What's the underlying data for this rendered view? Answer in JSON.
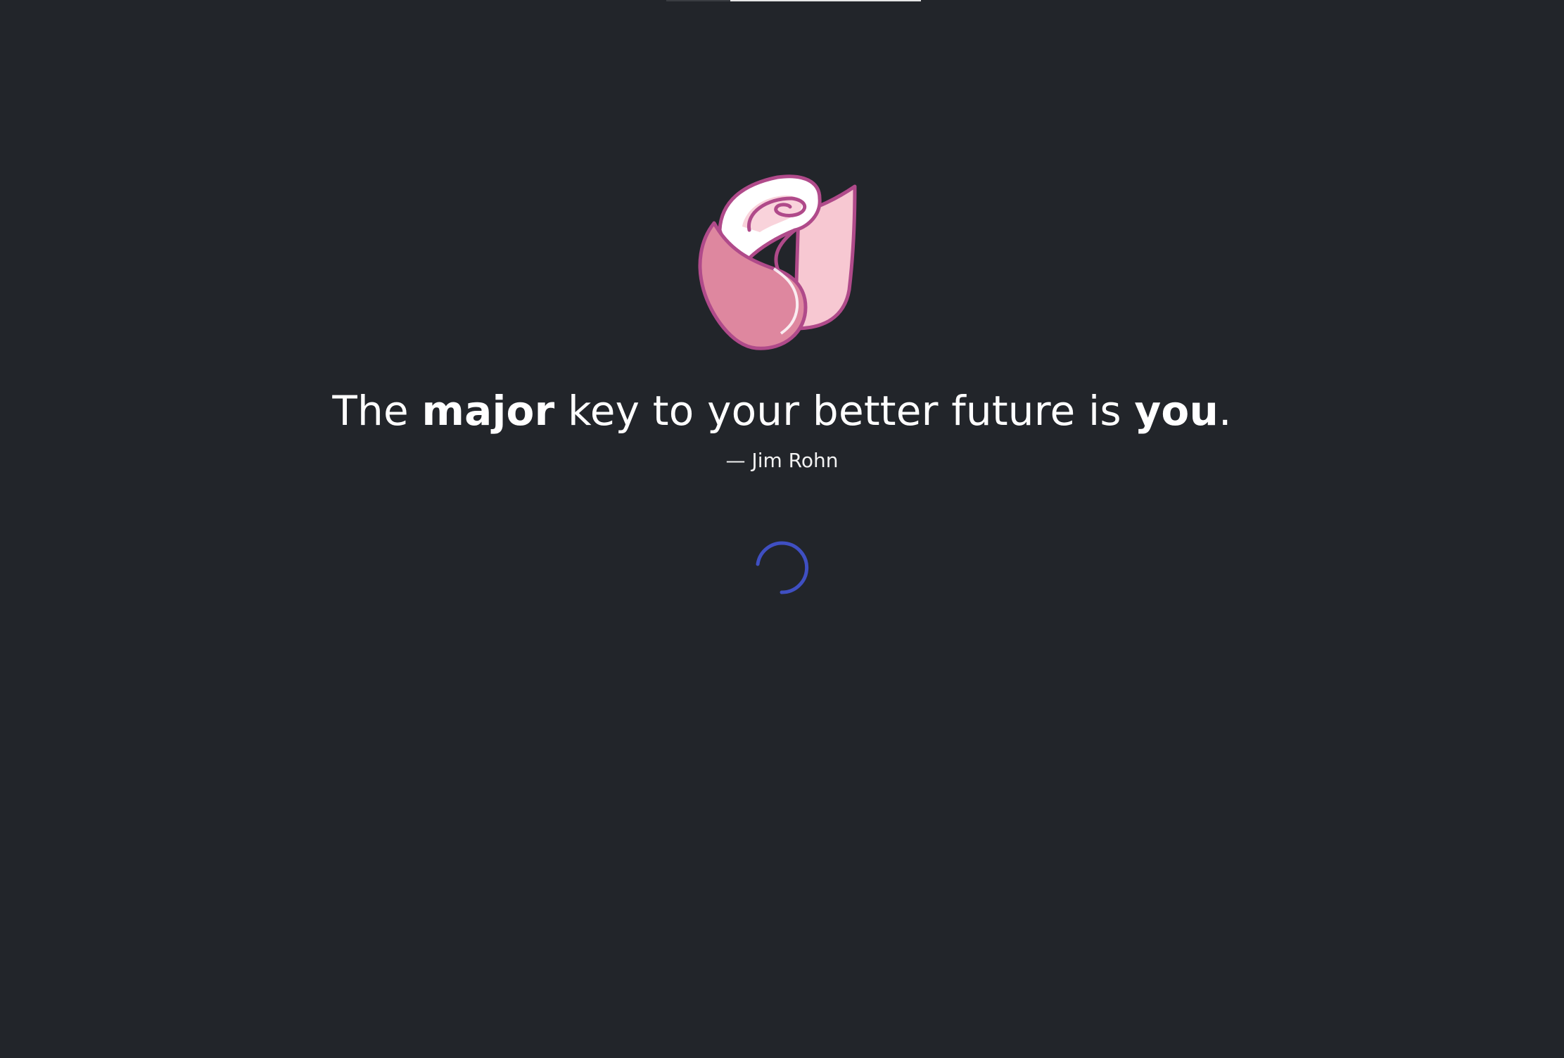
{
  "loader": {
    "progress_fraction": 0.75,
    "colors": {
      "background": "#22252a",
      "spinner": "#3f4fc2",
      "text": "#ffffff"
    }
  },
  "logo": {
    "icon": "rose-icon"
  },
  "quote": {
    "part1": "The ",
    "bold1": "major",
    "part2": " key to your better future is ",
    "bold2": "you",
    "part3": ".",
    "author": "— Jim Rohn"
  },
  "spinner": {
    "icon": "loading-spinner-icon",
    "state": "loading"
  }
}
